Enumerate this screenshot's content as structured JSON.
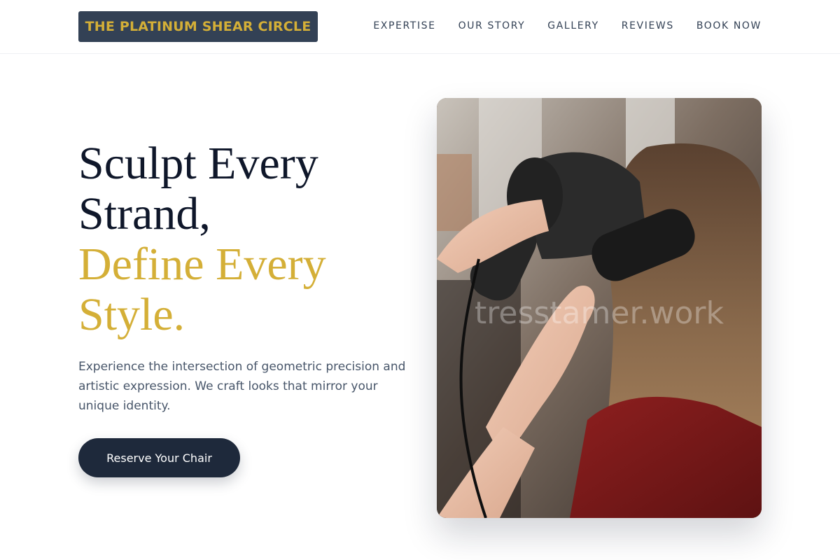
{
  "brand": {
    "name": "THE PLATINUM SHEAR CIRCLE"
  },
  "nav": {
    "items": [
      "EXPERTISE",
      "OUR STORY",
      "GALLERY",
      "REVIEWS",
      "BOOK NOW"
    ]
  },
  "hero": {
    "headline_line1": "Sculpt Every",
    "headline_line2": "Strand,",
    "headline_accent_line1": "Define Every",
    "headline_accent_line2": "Style.",
    "description": "Experience the intersection of geometric precision and artistic expression. We craft looks that mirror your unique identity.",
    "cta_label": "Reserve Your Chair",
    "image_watermark": "tresstamer.work"
  },
  "colors": {
    "accent_gold": "#d4af37",
    "dark_navy": "#1e293b",
    "logo_bg": "#334155"
  }
}
